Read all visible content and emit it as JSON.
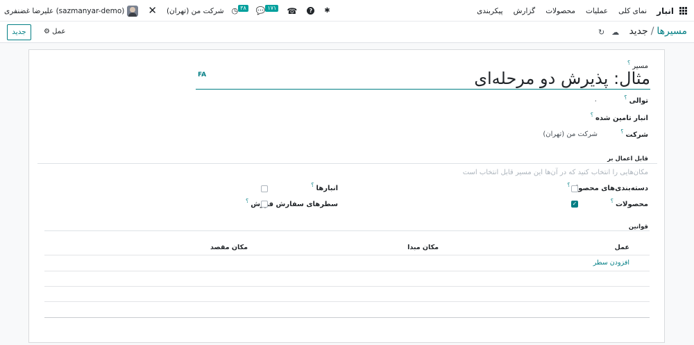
{
  "navbar": {
    "brand": "انبار",
    "menu": [
      "نمای کلی",
      "عملیات",
      "محصولات",
      "گزارش",
      "پیکربندی"
    ],
    "user": "علیرضا غضنفری (sazmanyar-demo)",
    "company": "شرکت من (تهران)",
    "activity_count": "۳۸",
    "messages_count": "۱۷۱",
    "icons": [
      "apps-icon",
      "bug-icon",
      "help-icon",
      "phone-icon",
      "chat-icon",
      "clock-icon",
      "tools-icon",
      "avatar"
    ]
  },
  "control_panel": {
    "breadcrumb_parent": "مسیرها",
    "breadcrumb_separator": "/",
    "breadcrumb_current": "جدید",
    "new_button": "جدید",
    "action_label": "عمل",
    "icons": [
      "save-cloud-icon",
      "discard-icon",
      "gear-icon"
    ]
  },
  "form": {
    "route_label": "مسیر",
    "title": "مثال: پذیرش دو مرحله‌ای",
    "lang": "FA",
    "q": "؟",
    "sequence_label": "توالی",
    "sequence_value": "۰",
    "supplied_wh_label": "انبار تامین شده",
    "company_label": "شرکت",
    "company_value": "شرکت من (تهران)",
    "applicable_title": "قابل اعمال بر",
    "applicable_hint": "مکان‌هایی را انتخاب کنید که در آن‌ها این مسیر قابل انتخاب است",
    "product_categories_label": "دسته‌بندی‌های محصول",
    "products_label": "محصولات",
    "warehouses_label": "انبارها",
    "sale_lines_label": "سطرهای سفارش فروش",
    "checked": {
      "product_categories": false,
      "products": true,
      "warehouses": false,
      "sale_lines": false
    },
    "rules_title": "قوانین",
    "rules_columns": [
      "عمل",
      "مکان مبدا",
      "مکان مقصد"
    ],
    "add_line": "افزودن سطر"
  }
}
